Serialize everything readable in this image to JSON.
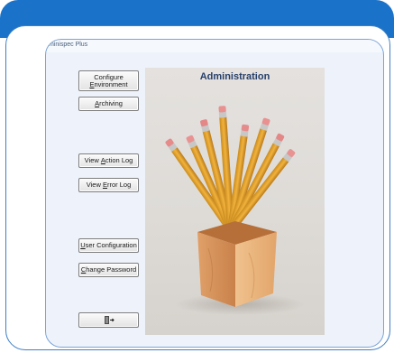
{
  "window": {
    "title": "minispec Plus"
  },
  "buttons": {
    "configure_environment": {
      "line1": "Configure",
      "line2_pre": "",
      "line2_ul": "E",
      "line2_post": "nvironment"
    },
    "archiving": {
      "pre": "",
      "ul": "A",
      "post": "rchiving"
    },
    "view_action_log": {
      "pre": "View ",
      "ul": "A",
      "post": "ction Log"
    },
    "view_error_log": {
      "pre": "View ",
      "ul": "E",
      "post": "rror Log"
    },
    "user_configuration": {
      "pre": "",
      "ul": "U",
      "post": "ser Configuration"
    },
    "change_password": {
      "pre": "",
      "ul": "C",
      "post": "hange Password"
    },
    "exit_icon": "exit-door-icon"
  },
  "panel": {
    "title": "Administration"
  },
  "colors": {
    "header": "#1a73c9",
    "panel_title": "#27406b"
  }
}
